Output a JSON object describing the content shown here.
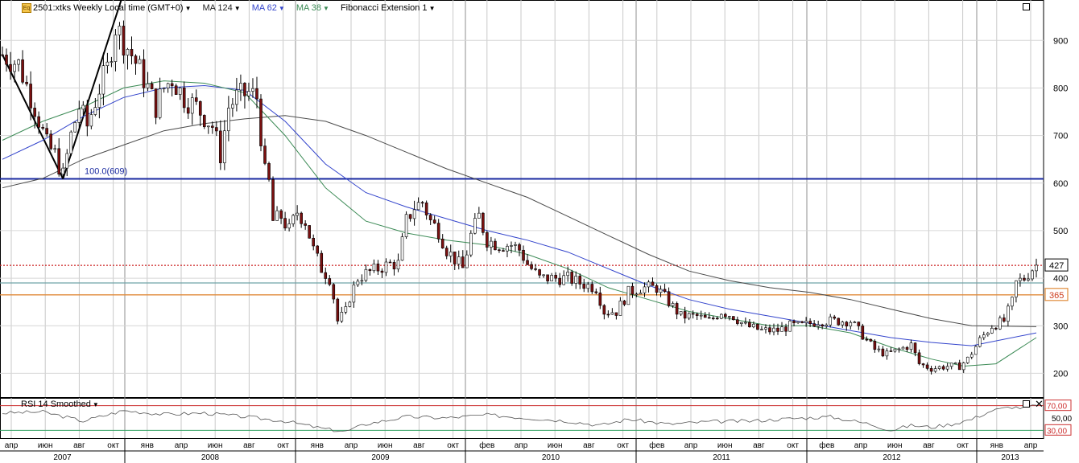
{
  "header": {
    "instrument_icon": "exchange-icon",
    "instrument": "2501:xtks Weekly Local time (GMT+0)",
    "indicators": [
      {
        "label": "MA 124",
        "color": "#4a4a4a"
      },
      {
        "label": "MA 62",
        "color": "#3344cc"
      },
      {
        "label": "MA 38",
        "color": "#3b8a55"
      },
      {
        "label": "Fibonacci Extension 1",
        "color": "#000000"
      }
    ]
  },
  "rsi_panel": {
    "label": "RSI 14 Smoothed",
    "levels": [
      "70,00",
      "50,00",
      "30,00"
    ]
  },
  "price_tags": {
    "current": "427",
    "level": "365"
  },
  "fib_label": "100.0(609)",
  "chart_data": {
    "type": "candlestick",
    "interval": "weekly",
    "y_ticks": [
      200,
      300,
      400,
      500,
      600,
      700,
      800,
      900
    ],
    "ylim": [
      150,
      985
    ],
    "month_labels": [
      "апр",
      "июн",
      "авг",
      "окт",
      "янв",
      "апр",
      "июн",
      "авг",
      "окт",
      "янв",
      "апр",
      "июн",
      "авг",
      "окт",
      "фев",
      "апр",
      "июн",
      "авг",
      "окт",
      "фев",
      "апр",
      "июн",
      "авг",
      "окт",
      "фев",
      "апр",
      "июн",
      "авг",
      "окт",
      "янв",
      "апр"
    ],
    "year_labels": [
      "2007",
      "2008",
      "2009",
      "2010",
      "2011",
      "2012",
      "2013"
    ],
    "close_anchors": [
      [
        0,
        870
      ],
      [
        4,
        850
      ],
      [
        8,
        760
      ],
      [
        11,
        680
      ],
      [
        13,
        660
      ],
      [
        15,
        615
      ],
      [
        17,
        700
      ],
      [
        19,
        760
      ],
      [
        21,
        720
      ],
      [
        24,
        800
      ],
      [
        26,
        840
      ],
      [
        28,
        930
      ],
      [
        30,
        900
      ],
      [
        32,
        870
      ],
      [
        35,
        820
      ],
      [
        38,
        760
      ],
      [
        40,
        800
      ],
      [
        42,
        820
      ],
      [
        45,
        780
      ],
      [
        48,
        760
      ],
      [
        50,
        740
      ],
      [
        52,
        720
      ],
      [
        54,
        660
      ],
      [
        56,
        760
      ],
      [
        58,
        780
      ],
      [
        61,
        790
      ],
      [
        63,
        780
      ],
      [
        64,
        700
      ],
      [
        65,
        620
      ],
      [
        66,
        600
      ],
      [
        67,
        520
      ],
      [
        69,
        530
      ],
      [
        71,
        500
      ],
      [
        73,
        540
      ],
      [
        75,
        520
      ],
      [
        77,
        460
      ],
      [
        79,
        420
      ],
      [
        81,
        400
      ],
      [
        82,
        360
      ],
      [
        83,
        310
      ],
      [
        85,
        330
      ],
      [
        86,
        360
      ],
      [
        88,
        400
      ],
      [
        90,
        410
      ],
      [
        93,
        420
      ],
      [
        96,
        430
      ],
      [
        98,
        430
      ],
      [
        100,
        520
      ],
      [
        102,
        550
      ],
      [
        104,
        560
      ],
      [
        106,
        520
      ],
      [
        108,
        500
      ],
      [
        110,
        460
      ],
      [
        112,
        440
      ],
      [
        114,
        420
      ],
      [
        116,
        490
      ],
      [
        118,
        530
      ],
      [
        120,
        480
      ],
      [
        123,
        470
      ],
      [
        126,
        470
      ],
      [
        128,
        460
      ],
      [
        130,
        430
      ],
      [
        133,
        400
      ],
      [
        136,
        400
      ],
      [
        140,
        400
      ],
      [
        143,
        390
      ],
      [
        147,
        380
      ],
      [
        149,
        330
      ],
      [
        152,
        330
      ],
      [
        155,
        370
      ],
      [
        158,
        380
      ],
      [
        162,
        380
      ],
      [
        166,
        340
      ],
      [
        168,
        320
      ],
      [
        172,
        320
      ],
      [
        175,
        310
      ],
      [
        178,
        330
      ],
      [
        181,
        320
      ],
      [
        184,
        300
      ],
      [
        188,
        290
      ],
      [
        192,
        290
      ],
      [
        195,
        300
      ],
      [
        198,
        300
      ],
      [
        202,
        310
      ],
      [
        206,
        310
      ],
      [
        210,
        310
      ],
      [
        213,
        280
      ],
      [
        216,
        250
      ],
      [
        219,
        240
      ],
      [
        222,
        250
      ],
      [
        225,
        260
      ],
      [
        227,
        220
      ],
      [
        230,
        210
      ],
      [
        234,
        215
      ],
      [
        237,
        215
      ],
      [
        239,
        230
      ],
      [
        242,
        270
      ],
      [
        245,
        300
      ],
      [
        248,
        310
      ],
      [
        250,
        350
      ],
      [
        251,
        390
      ],
      [
        253,
        400
      ],
      [
        255,
        420
      ],
      [
        256,
        427
      ]
    ],
    "ma_124": [
      [
        0,
        590
      ],
      [
        10,
        610
      ],
      [
        20,
        650
      ],
      [
        30,
        680
      ],
      [
        40,
        710
      ],
      [
        50,
        725
      ],
      [
        60,
        735
      ],
      [
        70,
        742
      ],
      [
        80,
        730
      ],
      [
        90,
        700
      ],
      [
        100,
        665
      ],
      [
        110,
        630
      ],
      [
        120,
        600
      ],
      [
        130,
        570
      ],
      [
        140,
        530
      ],
      [
        150,
        490
      ],
      [
        160,
        450
      ],
      [
        170,
        415
      ],
      [
        180,
        395
      ],
      [
        190,
        380
      ],
      [
        200,
        370
      ],
      [
        210,
        355
      ],
      [
        220,
        335
      ],
      [
        230,
        315
      ],
      [
        240,
        300
      ],
      [
        256,
        298
      ]
    ],
    "ma_62": [
      [
        0,
        650
      ],
      [
        10,
        690
      ],
      [
        20,
        740
      ],
      [
        30,
        780
      ],
      [
        40,
        800
      ],
      [
        50,
        805
      ],
      [
        60,
        795
      ],
      [
        70,
        730
      ],
      [
        80,
        640
      ],
      [
        90,
        580
      ],
      [
        100,
        550
      ],
      [
        110,
        525
      ],
      [
        120,
        500
      ],
      [
        130,
        480
      ],
      [
        140,
        455
      ],
      [
        150,
        420
      ],
      [
        160,
        385
      ],
      [
        170,
        355
      ],
      [
        180,
        335
      ],
      [
        190,
        320
      ],
      [
        200,
        305
      ],
      [
        210,
        290
      ],
      [
        220,
        275
      ],
      [
        230,
        265
      ],
      [
        240,
        258
      ],
      [
        256,
        285
      ]
    ],
    "ma_38": [
      [
        0,
        690
      ],
      [
        10,
        730
      ],
      [
        20,
        760
      ],
      [
        30,
        800
      ],
      [
        40,
        815
      ],
      [
        50,
        810
      ],
      [
        60,
        790
      ],
      [
        70,
        700
      ],
      [
        80,
        590
      ],
      [
        90,
        520
      ],
      [
        100,
        495
      ],
      [
        110,
        480
      ],
      [
        120,
        470
      ],
      [
        130,
        450
      ],
      [
        140,
        420
      ],
      [
        150,
        380
      ],
      [
        160,
        355
      ],
      [
        170,
        330
      ],
      [
        180,
        315
      ],
      [
        190,
        300
      ],
      [
        200,
        300
      ],
      [
        210,
        285
      ],
      [
        220,
        255
      ],
      [
        230,
        230
      ],
      [
        238,
        215
      ],
      [
        246,
        220
      ],
      [
        256,
        275
      ]
    ],
    "horizontal_lines": [
      {
        "name": "fib-100",
        "value": 609,
        "color": "#1a2aa0"
      },
      {
        "name": "current-price",
        "value": 427,
        "color": "#cc2020",
        "dotted": true
      },
      {
        "name": "support",
        "value": 390,
        "color": "#6fa3a8"
      },
      {
        "name": "level-365",
        "value": 365,
        "color": "#e08a3a"
      }
    ],
    "fibonacci_lines": [
      [
        [
          0,
          870
        ],
        [
          15,
          609
        ]
      ],
      [
        [
          15,
          609
        ],
        [
          30,
          1000
        ]
      ]
    ],
    "rsi_smoothed": [
      [
        0,
        58
      ],
      [
        10,
        60
      ],
      [
        20,
        45
      ],
      [
        30,
        62
      ],
      [
        40,
        56
      ],
      [
        50,
        58
      ],
      [
        60,
        52
      ],
      [
        70,
        45
      ],
      [
        80,
        32
      ],
      [
        85,
        28
      ],
      [
        90,
        40
      ],
      [
        100,
        52
      ],
      [
        110,
        50
      ],
      [
        120,
        55
      ],
      [
        130,
        50
      ],
      [
        140,
        45
      ],
      [
        148,
        38
      ],
      [
        155,
        48
      ],
      [
        165,
        40
      ],
      [
        175,
        44
      ],
      [
        185,
        45
      ],
      [
        195,
        49
      ],
      [
        205,
        52
      ],
      [
        210,
        46
      ],
      [
        215,
        40
      ],
      [
        220,
        30
      ],
      [
        225,
        38
      ],
      [
        230,
        35
      ],
      [
        235,
        40
      ],
      [
        240,
        48
      ],
      [
        245,
        62
      ],
      [
        250,
        68
      ],
      [
        253,
        66
      ],
      [
        256,
        70
      ]
    ]
  }
}
